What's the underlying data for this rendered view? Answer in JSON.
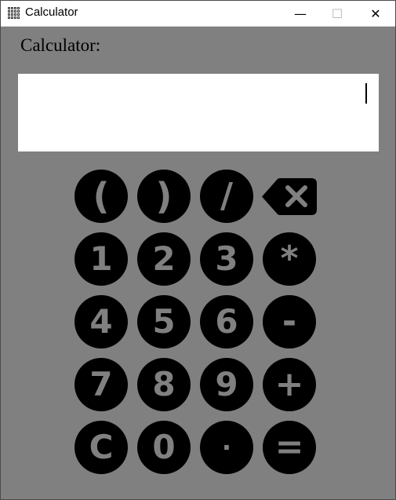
{
  "window": {
    "title": "Calculator",
    "controls": {
      "minimize": "—",
      "maximize": "☐",
      "close": "✕"
    }
  },
  "app": {
    "label": "Calculator:",
    "display_value": ""
  },
  "keypad": {
    "open_paren": "(",
    "close_paren": ")",
    "divide": "/",
    "backspace_icon": "backspace-icon",
    "one": "1",
    "two": "2",
    "three": "3",
    "multiply": "*",
    "four": "4",
    "five": "5",
    "six": "6",
    "minus": "-",
    "seven": "7",
    "eight": "8",
    "nine": "9",
    "plus": "+",
    "clear": "C",
    "zero": "0",
    "decimal": "·",
    "equals": "="
  },
  "colors": {
    "background": "#808080",
    "button": "#000000",
    "button_text": "#808080",
    "display": "#ffffff"
  }
}
